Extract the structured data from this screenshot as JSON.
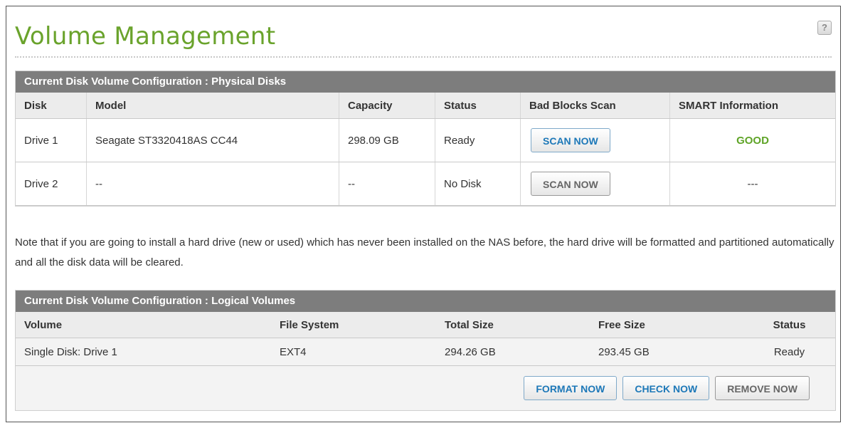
{
  "page": {
    "title": "Volume Management",
    "help_icon": "?"
  },
  "physical": {
    "header": "Current Disk Volume Configuration : Physical Disks",
    "columns": [
      "Disk",
      "Model",
      "Capacity",
      "Status",
      "Bad Blocks Scan",
      "SMART Information"
    ],
    "rows": [
      {
        "disk": "Drive 1",
        "model": "Seagate ST3320418AS CC44",
        "capacity": "298.09 GB",
        "status": "Ready",
        "scan_label": "SCAN NOW",
        "smart": "GOOD"
      },
      {
        "disk": "Drive 2",
        "model": "--",
        "capacity": "--",
        "status": "No Disk",
        "scan_label": "SCAN NOW",
        "smart": "---"
      }
    ]
  },
  "note": "Note that if you are going to install a hard drive (new or used) which has never been installed on the NAS before, the hard drive will be formatted and partitioned automatically and all the disk data will be cleared.",
  "logical": {
    "header": "Current Disk Volume Configuration : Logical Volumes",
    "columns": [
      "Volume",
      "File System",
      "Total Size",
      "Free Size",
      "Status"
    ],
    "rows": [
      {
        "volume": "Single Disk: Drive 1",
        "fs": "EXT4",
        "total": "294.26 GB",
        "free": "293.45 GB",
        "status": "Ready"
      }
    ],
    "buttons": {
      "format": "FORMAT NOW",
      "check": "CHECK NOW",
      "remove": "REMOVE NOW"
    }
  },
  "colors": {
    "title_green": "#6aa32c",
    "header_gray": "#7d7d7d",
    "good_green": "#5fa427",
    "button_blue": "#1d78b8"
  }
}
